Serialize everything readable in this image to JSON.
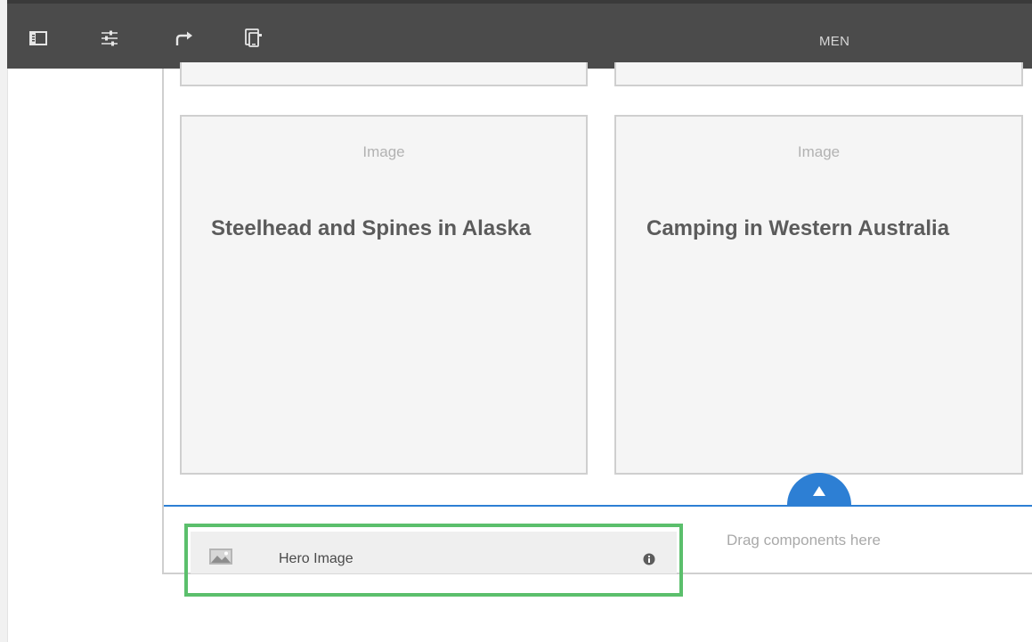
{
  "toolbar": {
    "icons": [
      "side-panel-icon",
      "sliders-icon",
      "redo-icon",
      "device-preview-icon"
    ],
    "page_label": "MEN"
  },
  "cards": [
    {
      "image_label": "Image",
      "title": "Steelhead and Spines in Alaska"
    },
    {
      "image_label": "Image",
      "title": "Camping in Western Australia"
    }
  ],
  "drop_zone": {
    "label": "Drag components here"
  },
  "dragged_component": {
    "label": "Hero Image",
    "icon": "image-icon",
    "info_icon": "info-icon"
  },
  "colors": {
    "toolbar_bg": "#4b4b4b",
    "accent": "#2d7fd4",
    "highlight": "#5bbf6c"
  }
}
